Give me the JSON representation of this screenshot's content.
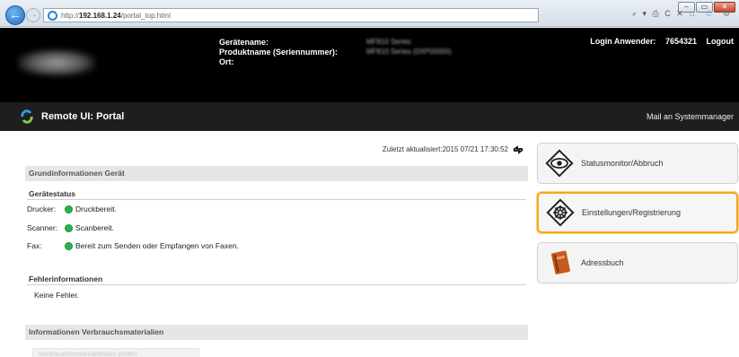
{
  "browser": {
    "window_buttons": [
      "–",
      "▭",
      "✕"
    ],
    "url_prefix": "http://",
    "url_host": "192.168.1.24",
    "url_path": "/portal_top.html",
    "toolbar_icons": "⌕ ▾ ⎙ C ✕",
    "tab_icons": "⌂ ☆ ⚙"
  },
  "device": {
    "name_label": "Gerätename:",
    "product_label": "Produktname (Seriennummer):",
    "location_label": "Ort:",
    "name_value": "MF810 Series",
    "product_value": "MF810 Series (0XP00000)",
    "login_label": "Login Anwender:",
    "login_user": "7654321",
    "logout_label": "Logout"
  },
  "appbar": {
    "title": "Remote UI: Portal",
    "mail_link": "Mail an Systemmanager"
  },
  "main": {
    "last_updated": "Zuletzt aktualisiert:2015 07/21 17:30:52",
    "basic_info_title": "Grundinformationen Gerät",
    "device_status_heading": "Gerätestatus",
    "status_rows": [
      {
        "label": "Drucker:",
        "text": "Druckbereit."
      },
      {
        "label": "Scanner:",
        "text": "Scanbereit."
      },
      {
        "label": "Fax:",
        "text": "Bereit zum Senden oder Empfangen von Faxen."
      }
    ],
    "error_heading": "Fehlerinformationen",
    "error_text": "Keine Fehler.",
    "consumables_title": "Informationen Verbrauchsmaterialien",
    "consumables_button": "Verbrauchsmaterialdetails prüfen"
  },
  "menu": {
    "items": [
      {
        "label": "Statusmonitor/Abbruch",
        "icon": "eye-diamond-icon"
      },
      {
        "label": "Einstellungen/Registrierung",
        "icon": "settings-diamond-icon"
      },
      {
        "label": "Adressbuch",
        "icon": "address-book-icon"
      }
    ]
  },
  "colors": {
    "header_bg": "#000000",
    "appbar_bg": "#1e1e1e",
    "section_bar": "#e6e6e6",
    "status_green": "#2bb34a",
    "highlight_orange": "#f5a623"
  }
}
